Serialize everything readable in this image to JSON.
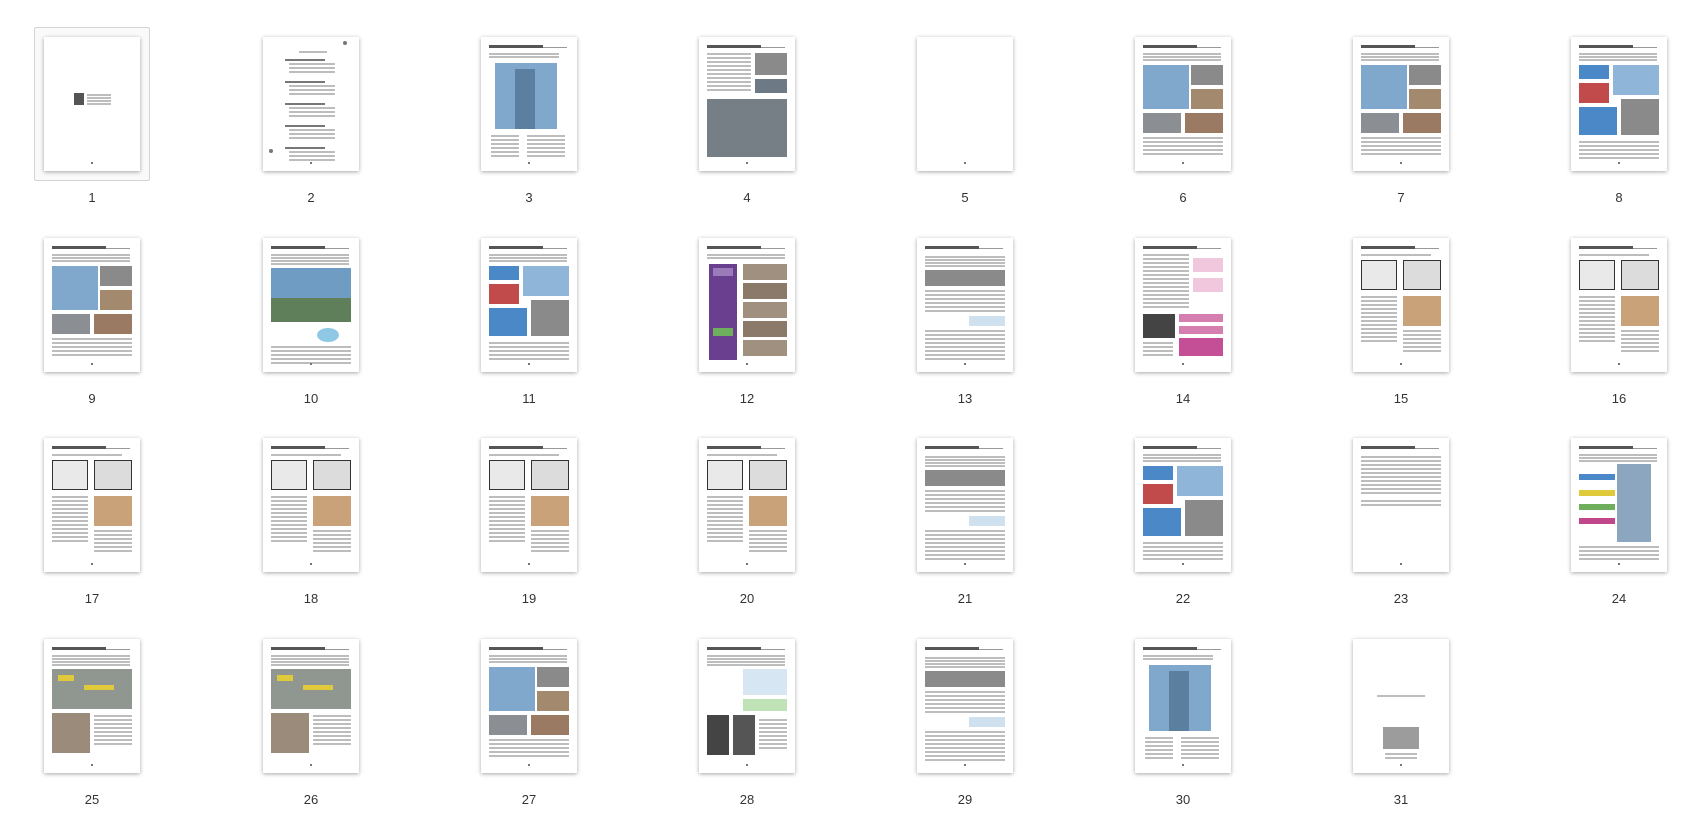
{
  "pages": [
    {
      "label": "1",
      "style": "cover"
    },
    {
      "label": "2",
      "style": "toc"
    },
    {
      "label": "3",
      "style": "tower"
    },
    {
      "label": "4",
      "style": "aerial"
    },
    {
      "label": "5",
      "style": "blank"
    },
    {
      "label": "6",
      "style": "photos"
    },
    {
      "label": "7",
      "style": "photos"
    },
    {
      "label": "8",
      "style": "diagram"
    },
    {
      "label": "9",
      "style": "photos"
    },
    {
      "label": "10",
      "style": "landscape"
    },
    {
      "label": "11",
      "style": "diagram"
    },
    {
      "label": "12",
      "style": "purple"
    },
    {
      "label": "13",
      "style": "text"
    },
    {
      "label": "14",
      "style": "pink"
    },
    {
      "label": "15",
      "style": "floor"
    },
    {
      "label": "16",
      "style": "floor"
    },
    {
      "label": "17",
      "style": "floor"
    },
    {
      "label": "18",
      "style": "floor"
    },
    {
      "label": "19",
      "style": "floor"
    },
    {
      "label": "20",
      "style": "floor"
    },
    {
      "label": "21",
      "style": "text"
    },
    {
      "label": "22",
      "style": "diagram"
    },
    {
      "label": "23",
      "style": "text-short"
    },
    {
      "label": "24",
      "style": "section"
    },
    {
      "label": "25",
      "style": "map"
    },
    {
      "label": "26",
      "style": "map"
    },
    {
      "label": "27",
      "style": "photos"
    },
    {
      "label": "28",
      "style": "chart"
    },
    {
      "label": "29",
      "style": "text"
    },
    {
      "label": "30",
      "style": "tower"
    },
    {
      "label": "31",
      "style": "back"
    }
  ],
  "selected_index": 0,
  "colors": {
    "sky": "#7fa8cc",
    "glass": "#5b7f9e",
    "photo": "#8a8a8a",
    "purple": "#6b3f8f",
    "pink": "#d57fb0",
    "yellow": "#e0c93a",
    "green": "#6fae5c",
    "blue": "#4a88c7"
  }
}
